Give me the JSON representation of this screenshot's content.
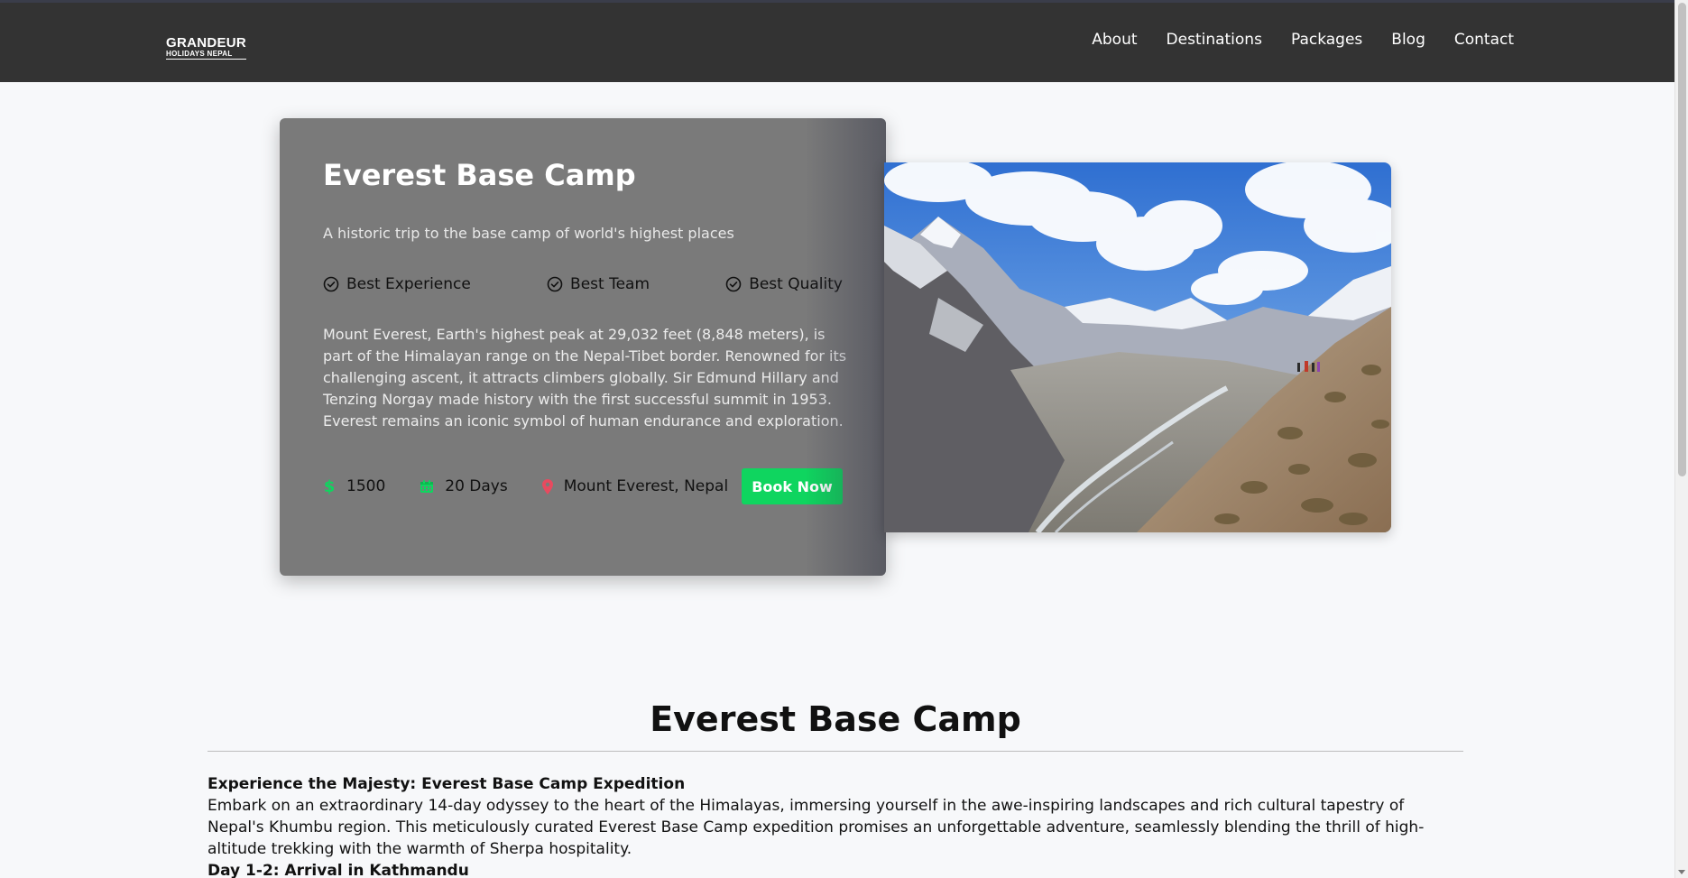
{
  "nav": {
    "logo": {
      "top": "GRANDEUR",
      "bottom": "HOLIDAYS NEPAL"
    },
    "links": [
      "About",
      "Destinations",
      "Packages",
      "Blog",
      "Contact"
    ]
  },
  "hero": {
    "title": "Everest Base Camp",
    "subtitle": "A historic trip to the base camp of world's highest places",
    "features": [
      "Best Experience",
      "Best Team",
      "Best Quality"
    ],
    "description": "Mount Everest, Earth's highest peak at 29,032 feet (8,848 meters), is part of the Himalayan range on the Nepal-Tibet border. Renowned for its challenging ascent, it attracts climbers globally. Sir Edmund Hillary and Tenzing Norgay made history with the first successful summit in 1953. Everest remains an iconic symbol of human endurance and exploration.",
    "price": "1500",
    "duration": "20 Days",
    "location": "Mount Everest, Nepal",
    "book_label": "Book Now"
  },
  "content": {
    "title": "Everest Base Camp",
    "heading1": "Experience the Majesty: Everest Base Camp Expedition",
    "paragraph1": "Embark on an extraordinary 14-day odyssey to the heart of the Himalayas, immersing yourself in the awe-inspiring landscapes and rich cultural tapestry of Nepal's Khumbu region. This meticulously curated Everest Base Camp expedition promises an unforgettable adventure, seamlessly blending the thrill of high-altitude trekking with the warmth of Sherpa hospitality.",
    "heading2": "Day 1-2: Arrival in Kathmandu"
  },
  "colors": {
    "accent": "#0fd55f",
    "navbar": "#333333",
    "card": "#7a7a7a",
    "pin": "#e84a5f"
  },
  "icons": [
    "check-circle-icon",
    "dollar-icon",
    "calendar-icon",
    "map-pin-icon",
    "stupa-icon"
  ]
}
